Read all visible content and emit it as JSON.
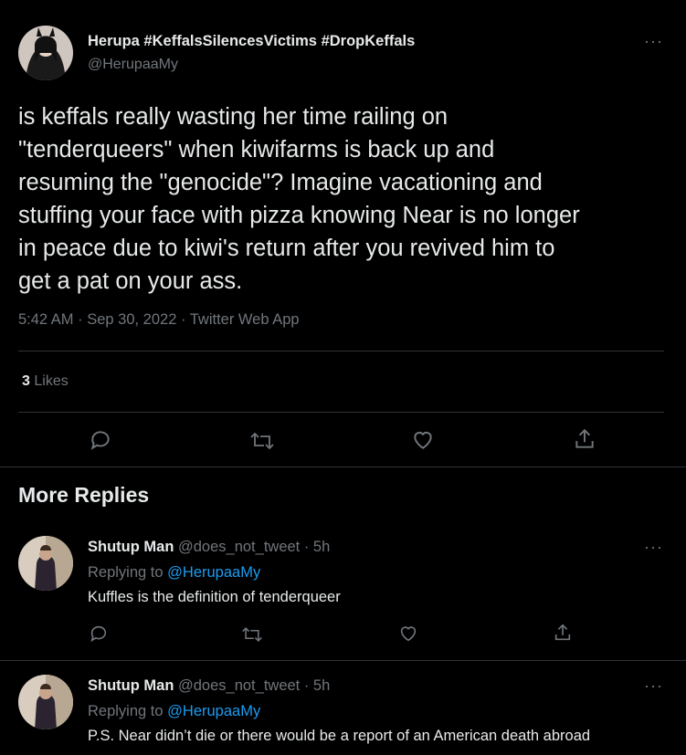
{
  "main_tweet": {
    "display_name": "Herupa #KeffalsSilencesVictims #DropKeffals",
    "handle": "@HerupaaMy",
    "text_lines": [
      "is keffals really wasting her time railing on",
      "\"tenderqueers\" when kiwifarms is back up and",
      "resuming the \"genocide\"? Imagine vacationing and",
      "stuffing your face with pizza knowing Near is no longer",
      "in peace due to kiwi's return after you revived him to",
      "get a pat on your ass."
    ],
    "timestamp": "5:42 AM · Sep 30, 2022 · Twitter Web App",
    "likes_count": "3",
    "likes_label": "Likes",
    "more_icon": "more-dots-icon"
  },
  "section_title": "More Replies",
  "replies": [
    {
      "display_name": "Shutup Man",
      "handle_time": "@does_not_tweet · 5h",
      "replying_prefix": "Replying to",
      "replying_handle": "@HerupaaMy",
      "text": "Kuffles is the definition of tenderqueer"
    },
    {
      "display_name": "Shutup Man",
      "handle_time": "@does_not_tweet · 5h",
      "replying_prefix": "Replying to",
      "replying_handle": "@HerupaaMy",
      "text": "P.S. Near didn’t die or there would be a report of an American death abroad"
    }
  ],
  "more_dots": "···",
  "colors": {
    "background": "#000000",
    "text": "#e7e9ea",
    "muted": "#71767b",
    "link": "#1d9bf0",
    "divider": "#2f3336"
  }
}
